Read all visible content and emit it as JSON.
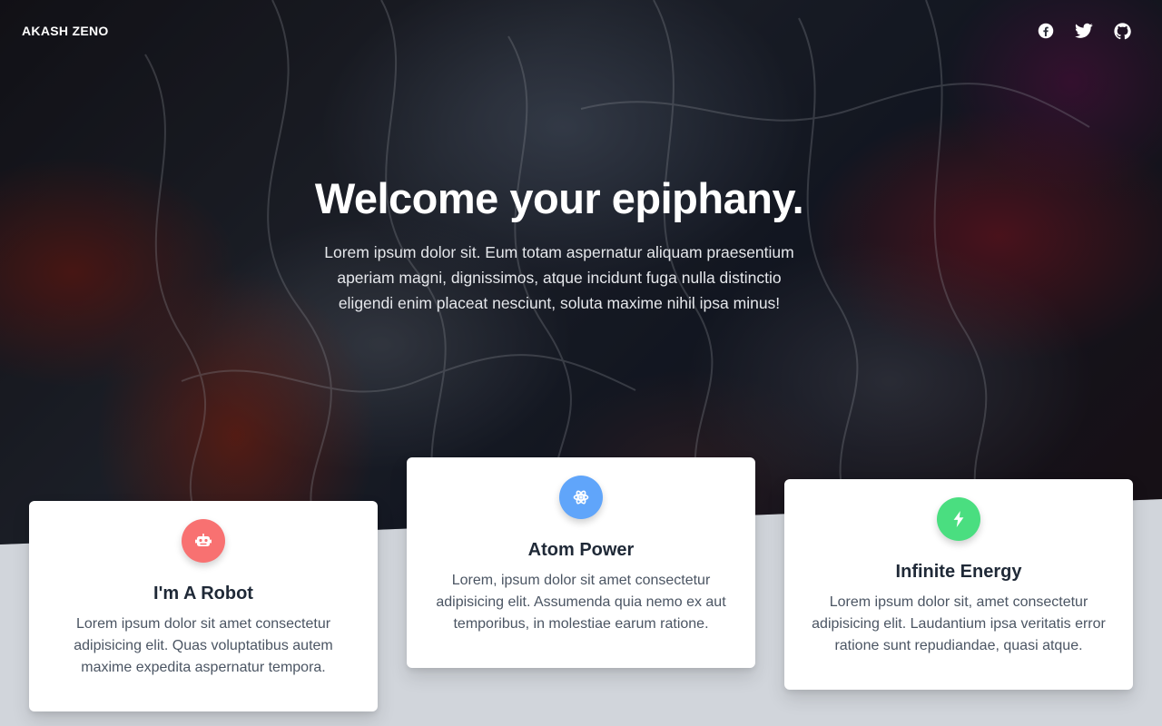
{
  "nav": {
    "brand": "AKASH ZENO",
    "social": [
      {
        "icon": "facebook-icon",
        "label": "Facebook"
      },
      {
        "icon": "twitter-icon",
        "label": "Twitter"
      },
      {
        "icon": "github-icon",
        "label": "GitHub"
      }
    ]
  },
  "hero": {
    "title": "Welcome your epiphany.",
    "subtitle": "Lorem ipsum dolor sit. Eum totam aspernatur aliquam praesentium aperiam magni, dignissimos, atque incidunt fuga nulla distinctio eligendi enim placeat nesciunt, soluta maxime nihil ipsa minus!"
  },
  "features": [
    {
      "icon": "robot-icon",
      "color": "#f87171",
      "title": "I'm A Robot",
      "text": "Lorem ipsum dolor sit amet consectetur adipisicing elit. Quas voluptatibus autem maxime expedita aspernatur tempora."
    },
    {
      "icon": "atom-icon",
      "color": "#60a5fa",
      "title": "Atom Power",
      "text": "Lorem, ipsum dolor sit amet consectetur adipisicing elit. Assumenda quia nemo ex aut temporibus, in molestiae earum ratione."
    },
    {
      "icon": "lightning-icon",
      "color": "#4ade80",
      "title": "Infinite Energy",
      "text": "Lorem ipsum dolor sit, amet consectetur adipisicing elit. Laudantium ipsa veritatis error ratione sunt repudiandae, quasi atque."
    }
  ]
}
